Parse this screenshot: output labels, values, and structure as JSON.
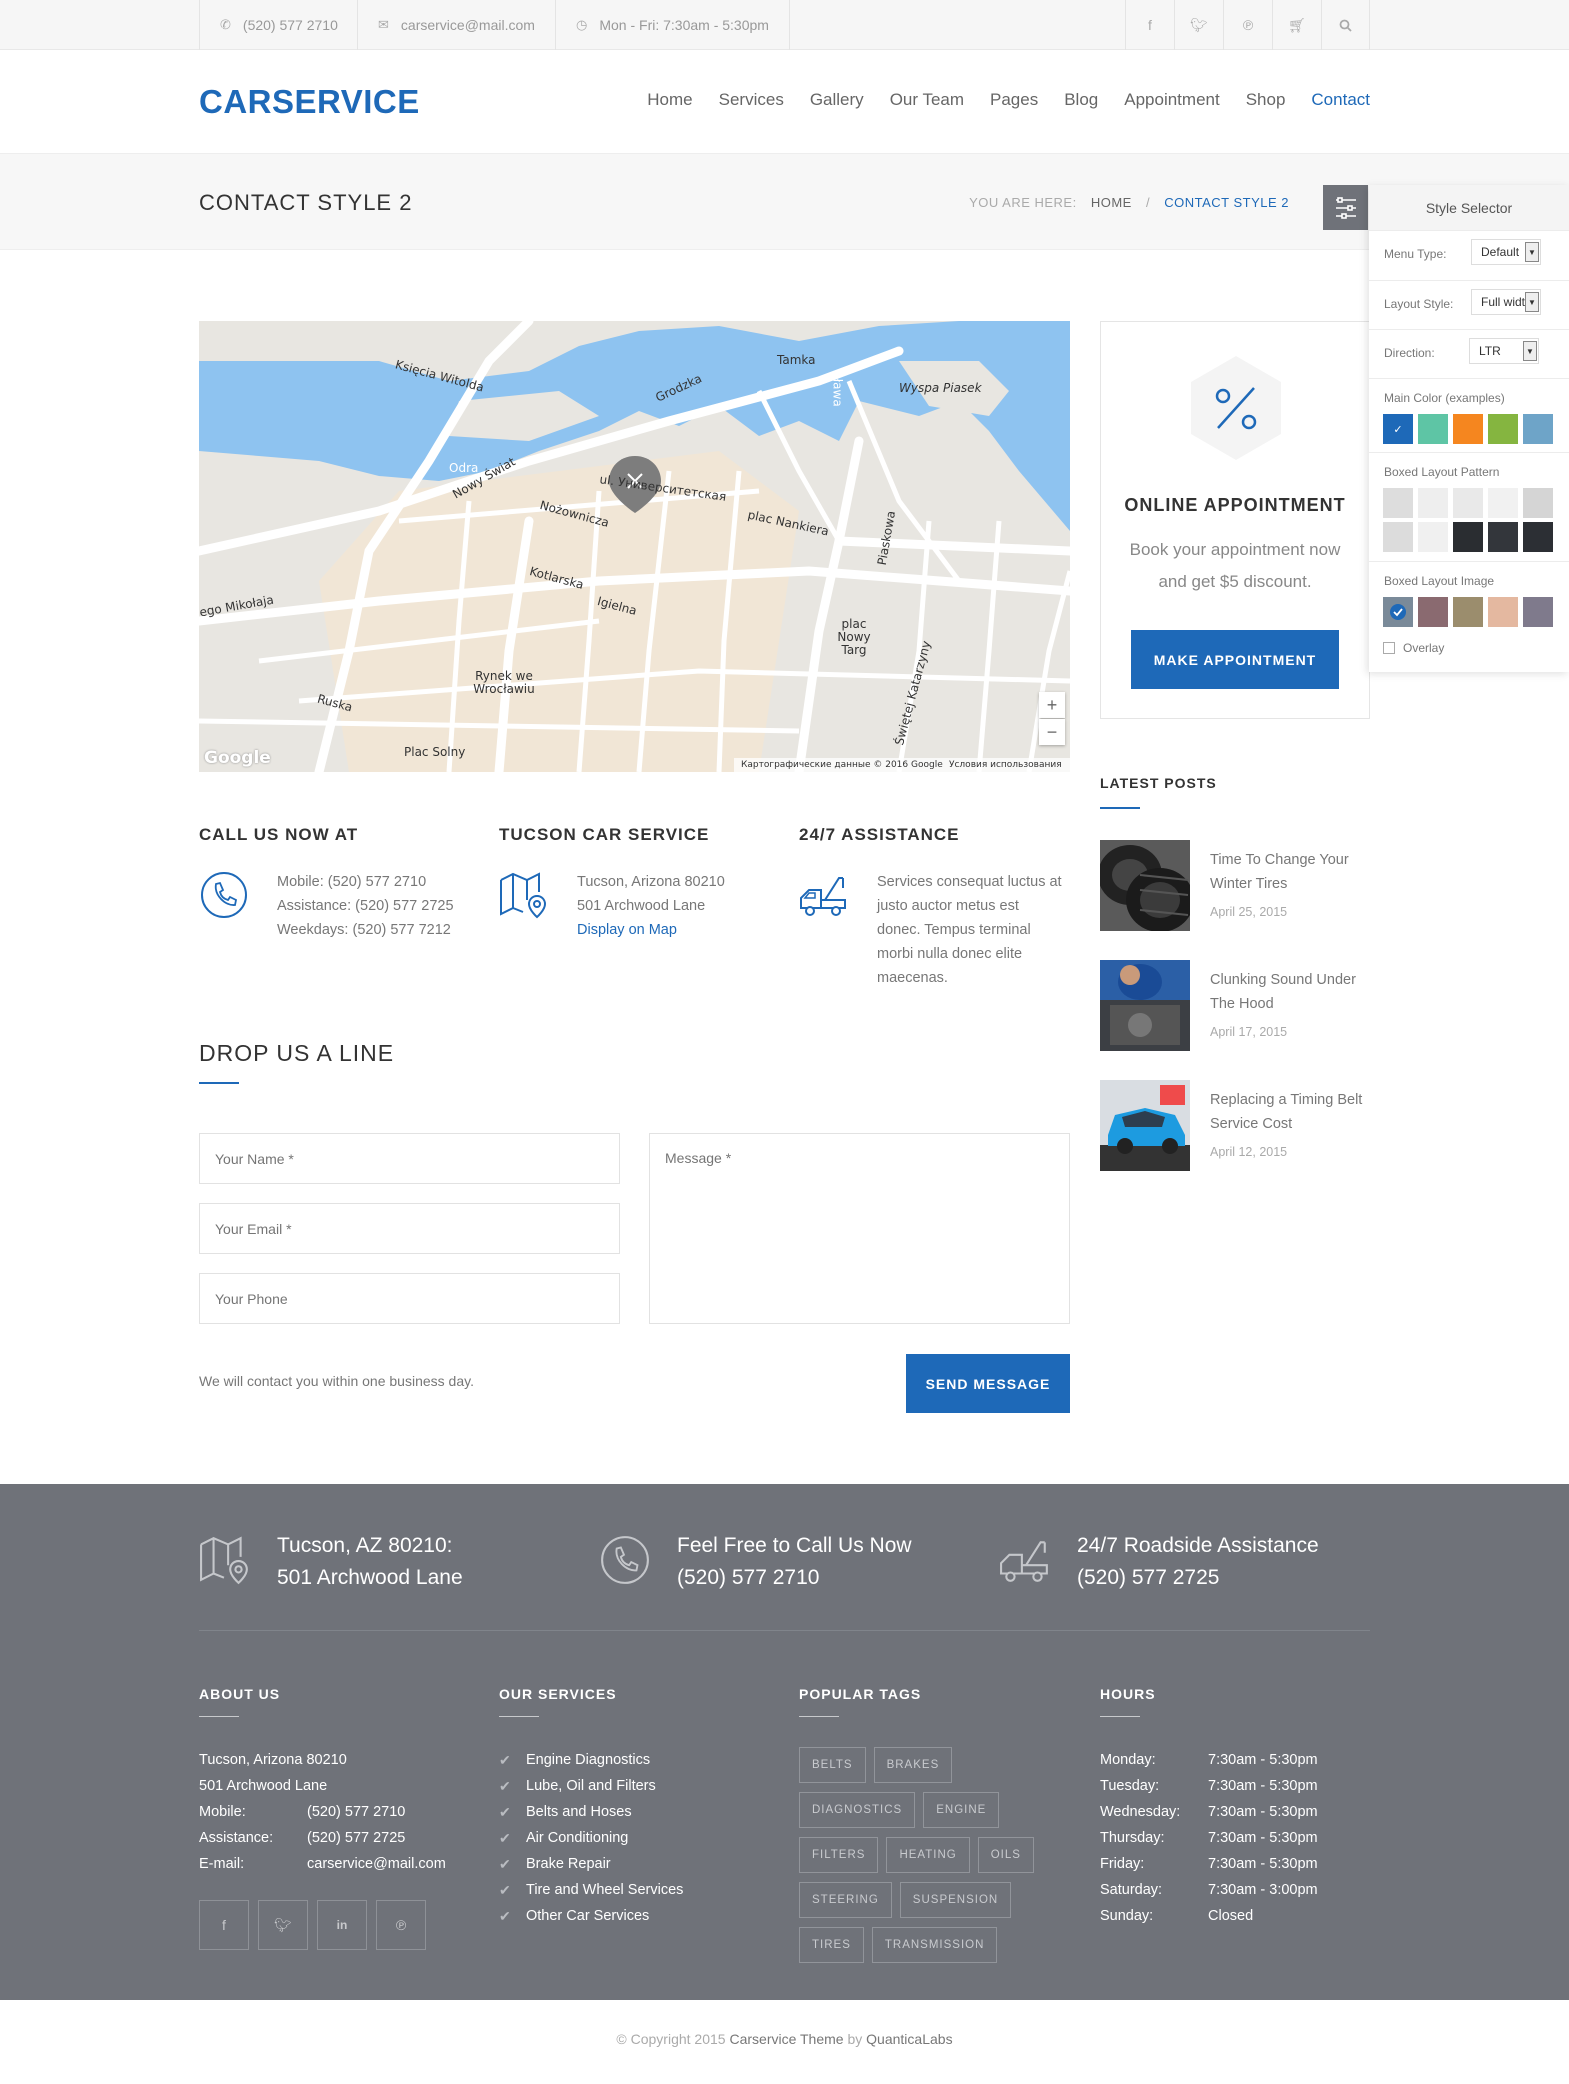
{
  "topbar": {
    "phone": "(520) 577 2710",
    "email": "carservice@mail.com",
    "hours": "Mon - Fri: 7:30am - 5:30pm",
    "icons": [
      "facebook-icon",
      "twitter-icon",
      "pinterest-icon",
      "cart-icon",
      "search-icon"
    ]
  },
  "header": {
    "logo": "CARSERVICE",
    "nav": [
      "Home",
      "Services",
      "Gallery",
      "Our Team",
      "Pages",
      "Blog",
      "Appointment",
      "Shop",
      "Contact"
    ],
    "active": "Contact"
  },
  "titlebar": {
    "title": "CONTACT STYLE 2",
    "breadcrumb_prefix": "YOU ARE HERE:",
    "breadcrumb_home": "HOME",
    "breadcrumb_sep": "/",
    "breadcrumb_current": "CONTACT STYLE 2"
  },
  "map": {
    "labels": [
      "Księcia Witolda",
      "Tamka",
      "Wyspa Piasek",
      "Grodzka",
      "Nowy Świat",
      "Nożownicza",
      "ul. Университетская",
      "plac Nankiera",
      "Kotlarska",
      "Igielna",
      "Piaskowa",
      "plac Nowy Targ",
      "Rynek we Wrocławiu",
      "Ruska",
      "Plac Solny",
      "ego Mikołaja",
      "Odra",
      "Oława",
      "Świętej Katarzyny"
    ],
    "attribution": "Картографические данные © 2016 Google",
    "terms": "Условия использования",
    "google": "Google",
    "zoom_in": "+",
    "zoom_out": "−"
  },
  "contact_info": [
    {
      "title": "CALL US NOW AT",
      "lines": [
        "Mobile: (520) 577 2710",
        "Assistance: (520) 577 2725",
        "Weekdays: (520) 577 7212"
      ]
    },
    {
      "title": "TUCSON CAR SERVICE",
      "lines": [
        "Tucson, Arizona 80210",
        "501 Archwood Lane"
      ],
      "link": "Display on Map"
    },
    {
      "title": "24/7 ASSISTANCE",
      "lines": [
        "Services consequat luctus at",
        "justo auctor metus est",
        "donec. Tempus terminal",
        "morbi nulla donec elite",
        "maecenas."
      ]
    }
  ],
  "form": {
    "title": "DROP US A LINE",
    "name_placeholder": "Your Name *",
    "email_placeholder": "Your Email *",
    "phone_placeholder": "Your Phone",
    "message_placeholder": "Message *",
    "note": "We will contact you within one business day.",
    "submit": "SEND MESSAGE"
  },
  "appointment": {
    "title": "ONLINE APPOINTMENT",
    "text": "Book your appointment now and get $5 discount.",
    "button": "MAKE APPOINTMENT"
  },
  "latest_posts": {
    "title": "LATEST POSTS",
    "posts": [
      {
        "title": "Time To Change Your Winter Tires",
        "date": "April 25, 2015"
      },
      {
        "title": "Clunking Sound Under The Hood",
        "date": "April 17, 2015"
      },
      {
        "title": "Replacing a Timing Belt Service Cost",
        "date": "April 12, 2015"
      }
    ]
  },
  "style_selector": {
    "title": "Style Selector",
    "menu_type_label": "Menu Type:",
    "menu_type_value": "Default",
    "layout_style_label": "Layout Style:",
    "layout_style_value": "Full width",
    "direction_label": "Direction:",
    "direction_value": "LTR",
    "main_color_label": "Main Color (examples)",
    "main_colors": [
      "#1e69b8",
      "#5ec5a5",
      "#f5861f",
      "#85b540",
      "#6ea4c8"
    ],
    "boxed_pattern_label": "Boxed Layout Pattern",
    "boxed_image_label": "Boxed Layout Image",
    "overlay_label": "Overlay",
    "check": "✓"
  },
  "footer": {
    "contacts": [
      {
        "line1": "Tucson, AZ 80210:",
        "line2": "501 Archwood Lane"
      },
      {
        "line1": "Feel Free to Call Us Now",
        "line2": "(520) 577 2710"
      },
      {
        "line1": "24/7 Roadside Assistance",
        "line2": "(520) 577 2725"
      }
    ],
    "about": {
      "title": "ABOUT US",
      "address1": "Tucson, Arizona 80210",
      "address2": "501 Archwood Lane",
      "mobile_k": "Mobile:",
      "mobile_v": "(520) 577 2710",
      "assist_k": "Assistance:",
      "assist_v": "(520) 577 2725",
      "email_k": "E-mail:",
      "email_v": "carservice@mail.com"
    },
    "services": {
      "title": "OUR SERVICES",
      "items": [
        "Engine Diagnostics",
        "Lube, Oil and Filters",
        "Belts and Hoses",
        "Air Conditioning",
        "Brake Repair",
        "Tire and Wheel Services",
        "Other Car Services"
      ]
    },
    "tags": {
      "title": "POPULAR TAGS",
      "items": [
        "BELTS",
        "BRAKES",
        "DIAGNOSTICS",
        "ENGINE",
        "FILTERS",
        "HEATING",
        "OILS",
        "STEERING",
        "SUSPENSION",
        "TIRES",
        "TRANSMISSION"
      ]
    },
    "hours": {
      "title": "HOURS",
      "rows": [
        {
          "day": "Monday:",
          "time": "7:30am - 5:30pm"
        },
        {
          "day": "Tuesday:",
          "time": "7:30am - 5:30pm"
        },
        {
          "day": "Wednesday:",
          "time": "7:30am - 5:30pm"
        },
        {
          "day": "Thursday:",
          "time": "7:30am - 5:30pm"
        },
        {
          "day": "Friday:",
          "time": "7:30am - 5:30pm"
        },
        {
          "day": "Saturday:",
          "time": "7:30am - 3:00pm"
        },
        {
          "day": "Sunday:",
          "time": "Closed"
        }
      ]
    },
    "social_icons": [
      "facebook-icon",
      "twitter-icon",
      "linkedin-icon",
      "pinterest-icon"
    ]
  },
  "copyright": {
    "prefix": "© Copyright 2015",
    "theme": "Carservice Theme",
    "by": "by",
    "author": "QuanticaLabs"
  }
}
